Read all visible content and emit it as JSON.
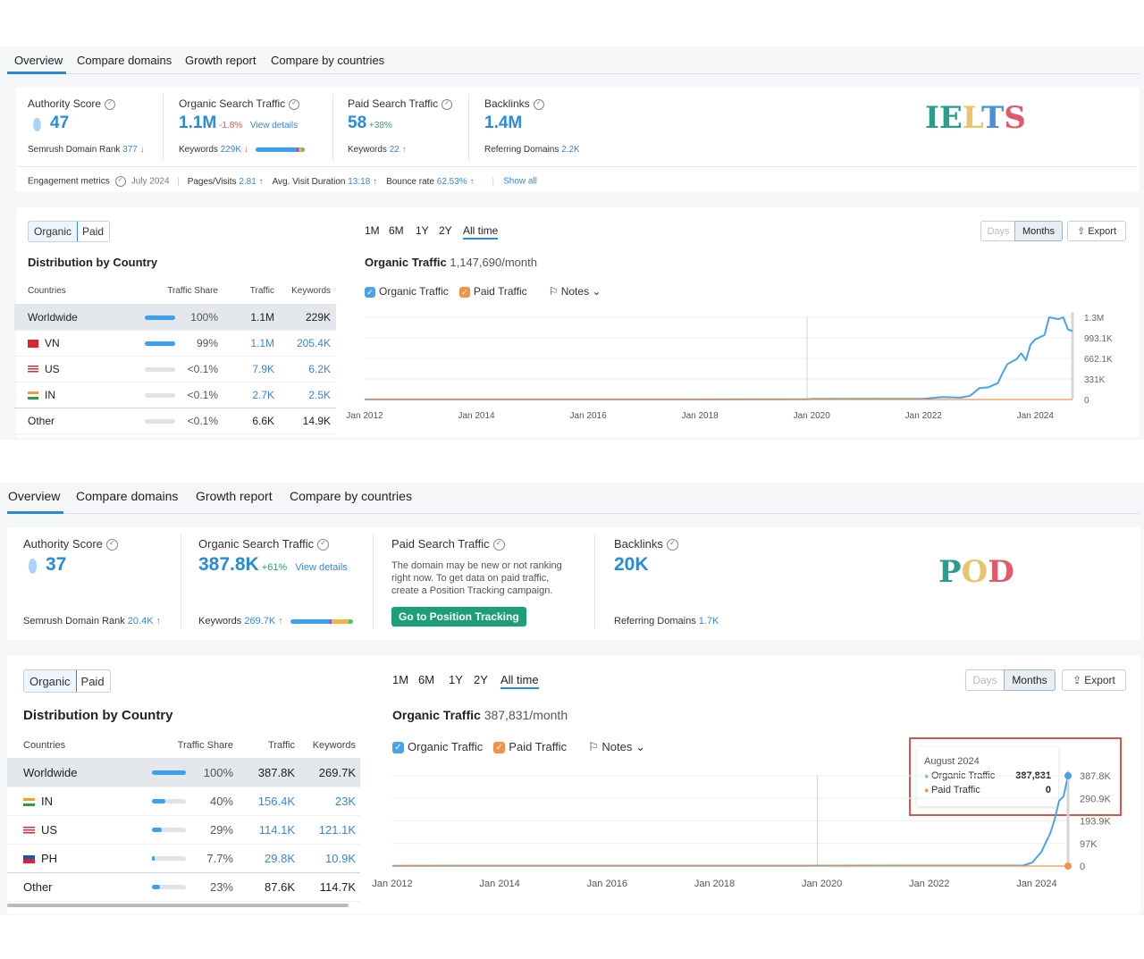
{
  "colors": {
    "accent": "#2a8ad8",
    "organic": "#4aa3e8",
    "paid": "#f0924a",
    "green_button": "#1e9e78",
    "negative": "#d9534f",
    "highlight_box": "#d9534f"
  },
  "panels": [
    {
      "tabs": [
        "Overview",
        "Compare domains",
        "Growth report",
        "Compare by countries"
      ],
      "active_tab": "Overview",
      "logo": {
        "text": "IELTS",
        "letters": [
          {
            "ch": "I",
            "color": "#2a9d8f"
          },
          {
            "ch": "E",
            "color": "#2a9d8f"
          },
          {
            "ch": "L",
            "color": "#e9c46a"
          },
          {
            "ch": "T",
            "color": "#4a90d9"
          },
          {
            "ch": "S",
            "color": "#e05a6a"
          }
        ]
      },
      "metrics": {
        "authority": {
          "label": "Authority Score",
          "value": "47",
          "sub_label": "Semrush Domain Rank",
          "sub_value": "377",
          "sub_trend": "↓"
        },
        "organic": {
          "label": "Organic Search Traffic",
          "value": "1.1M",
          "change": "-1.8%",
          "link": "View details",
          "sub_label": "Keywords",
          "sub_value": "229K",
          "sub_trend": "↓"
        },
        "paid": {
          "label": "Paid Search Traffic",
          "value": "58",
          "change": "+38%",
          "sub_label": "Keywords",
          "sub_value": "22",
          "sub_trend": "↑"
        },
        "backlinks": {
          "label": "Backlinks",
          "value": "1.4M",
          "sub_label": "Referring Domains",
          "sub_value": "2.2K"
        }
      },
      "engagement": {
        "label": "Engagement metrics",
        "date": "July 2024",
        "items": [
          {
            "label": "Pages/Visits",
            "value": "2.81 ↑"
          },
          {
            "label": "Avg. Visit Duration",
            "value": "13:18 ↑"
          },
          {
            "label": "Bounce rate",
            "value": "62.53% ↑"
          }
        ],
        "show_all": "Show all"
      },
      "distribution": {
        "toggle": [
          "Organic",
          "Paid"
        ],
        "toggle_active": "Organic",
        "title": "Distribution by Country",
        "columns": [
          "Countries",
          "Traffic Share",
          "Traffic",
          "Keywords"
        ],
        "rows": [
          {
            "country": "Worldwide",
            "flag": "",
            "share": "100%",
            "share_fraction": 1.0,
            "traffic": "1.1M",
            "keywords": "229K"
          },
          {
            "country": "VN",
            "flag": "vn",
            "share": "99%",
            "share_fraction": 0.99,
            "traffic": "1.1M",
            "keywords": "205.4K"
          },
          {
            "country": "US",
            "flag": "us",
            "share": "<0.1%",
            "share_fraction": 0.0,
            "traffic": "7.9K",
            "keywords": "6.2K"
          },
          {
            "country": "IN",
            "flag": "in",
            "share": "<0.1%",
            "share_fraction": 0.0,
            "traffic": "2.7K",
            "keywords": "2.5K"
          },
          {
            "country": "Other",
            "flag": "",
            "share": "<0.1%",
            "share_fraction": 0.0,
            "traffic": "6.6K",
            "keywords": "14.9K"
          }
        ]
      },
      "chart": {
        "periods": [
          "1M",
          "6M",
          "1Y",
          "2Y",
          "All time"
        ],
        "period_active": "All time",
        "title": "Organic Traffic",
        "title_value": "1,147,690/month",
        "legend": [
          "Organic Traffic",
          "Paid Traffic"
        ],
        "notes": "Notes",
        "granularity": [
          "Days",
          "Months"
        ],
        "granularity_active": "Months",
        "export": "Export",
        "type": "line",
        "y_ticks": [
          "1.3M",
          "993.1K",
          "662.1K",
          "331K",
          "0"
        ],
        "ylim": [
          0,
          1300000
        ],
        "x_ticks": [
          "Jan 2012",
          "Jan 2014",
          "Jan 2016",
          "Jan 2018",
          "Jan 2020",
          "Jan 2022",
          "Jan 2024"
        ],
        "x_range": [
          "2012-01",
          "2024-09"
        ],
        "series": [
          {
            "name": "Organic Traffic",
            "points": [
              [
                "2012-01",
                2000
              ],
              [
                "2019-12",
                3000
              ],
              [
                "2020-01",
                8000
              ],
              [
                "2021-06",
                10000
              ],
              [
                "2022-01",
                12000
              ],
              [
                "2022-05",
                40000
              ],
              [
                "2022-09",
                30000
              ],
              [
                "2022-11",
                60000
              ],
              [
                "2023-01",
                180000
              ],
              [
                "2023-03",
                195000
              ],
              [
                "2023-05",
                260000
              ],
              [
                "2023-06",
                420000
              ],
              [
                "2023-07",
                560000
              ],
              [
                "2023-09",
                640000
              ],
              [
                "2023-10",
                730000
              ],
              [
                "2023-11",
                620000
              ],
              [
                "2023-12",
                870000
              ],
              [
                "2024-01",
                950000
              ],
              [
                "2024-03",
                1020000
              ],
              [
                "2024-04",
                1300000
              ],
              [
                "2024-06",
                1270000
              ],
              [
                "2024-07",
                1300000
              ],
              [
                "2024-08",
                1110000
              ],
              [
                "2024-09",
                1080000
              ]
            ]
          },
          {
            "name": "Paid Traffic",
            "points": [
              [
                "2012-01",
                0
              ],
              [
                "2024-09",
                0
              ]
            ]
          }
        ]
      }
    },
    {
      "tabs": [
        "Overview",
        "Compare domains",
        "Growth report",
        "Compare by countries"
      ],
      "active_tab": "Overview",
      "logo": {
        "text": "POD",
        "letters": [
          {
            "ch": "P",
            "color": "#2a9d8f"
          },
          {
            "ch": "O",
            "color": "#e9c46a"
          },
          {
            "ch": "D",
            "color": "#e05a6a"
          }
        ]
      },
      "metrics": {
        "authority": {
          "label": "Authority Score",
          "value": "37",
          "sub_label": "Semrush Domain Rank",
          "sub_value": "20.4K",
          "sub_trend": "↑"
        },
        "organic": {
          "label": "Organic Search Traffic",
          "value": "387.8K",
          "change": "+61%",
          "link": "View details",
          "sub_label": "Keywords",
          "sub_value": "269.7K",
          "sub_trend": "↑"
        },
        "paid": {
          "label": "Paid Search Traffic",
          "message": "The domain may be new or not ranking right now. To get data on paid traffic, create a Position Tracking campaign.",
          "button": "Go to Position Tracking"
        },
        "backlinks": {
          "label": "Backlinks",
          "value": "20K",
          "sub_label": "Referring Domains",
          "sub_value": "1.7K"
        }
      },
      "distribution": {
        "toggle": [
          "Organic",
          "Paid"
        ],
        "toggle_active": "Organic",
        "title": "Distribution by Country",
        "columns": [
          "Countries",
          "Traffic Share",
          "Traffic",
          "Keywords"
        ],
        "rows": [
          {
            "country": "Worldwide",
            "flag": "",
            "share": "100%",
            "share_fraction": 1.0,
            "traffic": "387.8K",
            "keywords": "269.7K"
          },
          {
            "country": "IN",
            "flag": "in",
            "share": "40%",
            "share_fraction": 0.4,
            "traffic": "156.4K",
            "keywords": "23K"
          },
          {
            "country": "US",
            "flag": "us",
            "share": "29%",
            "share_fraction": 0.29,
            "traffic": "114.1K",
            "keywords": "121.1K"
          },
          {
            "country": "PH",
            "flag": "ph",
            "share": "7.7%",
            "share_fraction": 0.077,
            "traffic": "29.8K",
            "keywords": "10.9K"
          },
          {
            "country": "Other",
            "flag": "",
            "share": "23%",
            "share_fraction": 0.23,
            "traffic": "87.6K",
            "keywords": "114.7K"
          }
        ]
      },
      "chart": {
        "periods": [
          "1M",
          "6M",
          "1Y",
          "2Y",
          "All time"
        ],
        "period_active": "All time",
        "title": "Organic Traffic",
        "title_value": "387,831/month",
        "legend": [
          "Organic Traffic",
          "Paid Traffic"
        ],
        "notes": "Notes",
        "granularity": [
          "Days",
          "Months"
        ],
        "granularity_active": "Months",
        "export": "Export",
        "type": "line",
        "y_ticks": [
          "387.8K",
          "290.9K",
          "193.9K",
          "97K",
          "0"
        ],
        "ylim": [
          0,
          387831
        ],
        "x_ticks": [
          "Jan 2012",
          "Jan 2014",
          "Jan 2016",
          "Jan 2018",
          "Jan 2020",
          "Jan 2022",
          "Jan 2024"
        ],
        "x_range": [
          "2012-01",
          "2024-08"
        ],
        "series": [
          {
            "name": "Organic Traffic",
            "points": [
              [
                "2012-01",
                1000
              ],
              [
                "2023-10",
                2000
              ],
              [
                "2023-12",
                15000
              ],
              [
                "2024-02",
                60000
              ],
              [
                "2024-04",
                140000
              ],
              [
                "2024-05",
                200000
              ],
              [
                "2024-06",
                280000
              ],
              [
                "2024-07",
                300000
              ],
              [
                "2024-08",
                387831
              ]
            ]
          },
          {
            "name": "Paid Traffic",
            "points": [
              [
                "2012-01",
                0
              ],
              [
                "2024-08",
                0
              ]
            ]
          }
        ],
        "tooltip": {
          "date": "August 2024",
          "rows": [
            {
              "label": "Organic Traffic",
              "value": "387,831"
            },
            {
              "label": "Paid Traffic",
              "value": "0"
            }
          ]
        }
      }
    }
  ]
}
